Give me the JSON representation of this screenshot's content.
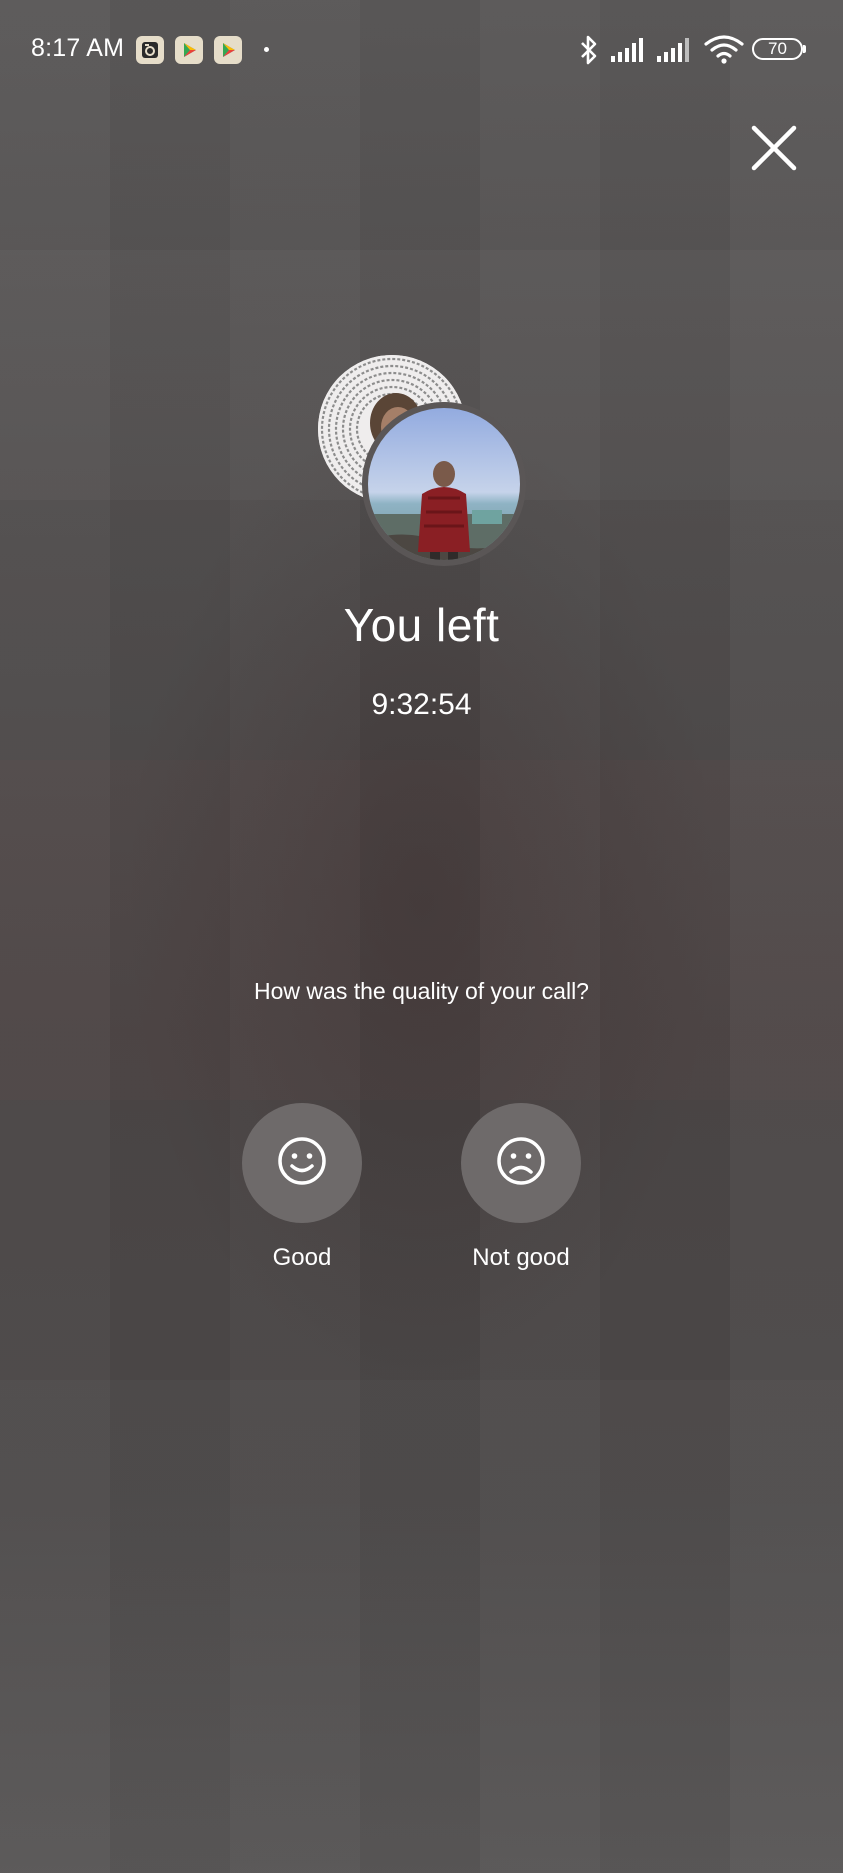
{
  "status_bar": {
    "time": "8:17 AM",
    "battery_level": "70",
    "notification_icons": [
      "camera-app-icon",
      "play-store-icon",
      "play-store-icon"
    ],
    "system_icons": [
      "bluetooth-icon",
      "signal-icon",
      "signal-icon",
      "wifi-icon",
      "battery-icon"
    ]
  },
  "call": {
    "status": "You left",
    "duration": "9:32:54"
  },
  "feedback": {
    "question": "How was the quality of your call?",
    "good_label": "Good",
    "not_good_label": "Not good"
  }
}
